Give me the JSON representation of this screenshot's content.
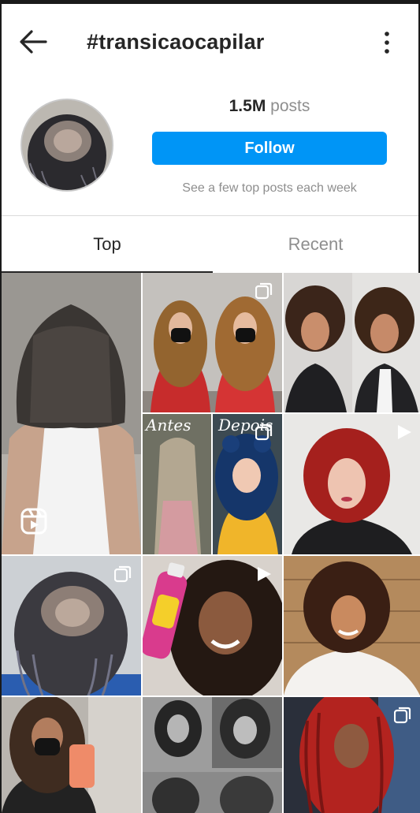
{
  "header": {
    "title": "#transicaocapilar",
    "back_icon": "arrow-left-icon",
    "more_icon": "more-vertical-icon"
  },
  "profile": {
    "posts_count": "1.5M",
    "posts_label": "posts",
    "follow_label": "Follow",
    "note": "See a few top posts each week"
  },
  "tabs": [
    {
      "label": "Top",
      "active": true
    },
    {
      "label": "Recent",
      "active": false
    }
  ],
  "posts": [
    {
      "badge": "reels-icon"
    },
    {
      "badge": "carousel-icon"
    },
    {
      "badge": null
    },
    {
      "badge": "carousel-icon",
      "captions": [
        "Antes",
        "Depois"
      ]
    },
    {
      "badge": "video-play-icon"
    },
    {
      "badge": "carousel-icon"
    },
    {
      "badge": "video-play-icon"
    },
    {
      "badge": null
    },
    {
      "badge": null
    },
    {
      "badge": null
    },
    {
      "badge": "carousel-icon"
    }
  ],
  "colors": {
    "accent": "#0095f6",
    "text": "#262626",
    "muted": "#8e8e8e",
    "divider": "#dbdbdb"
  }
}
